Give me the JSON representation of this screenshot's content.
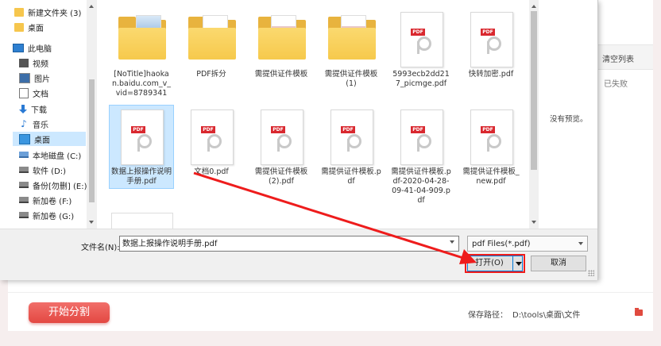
{
  "app": {
    "clear_list": "清空列表",
    "failed": "已失败",
    "start_button": "开始分割",
    "save_label": "保存路径：",
    "save_path": "D:\\tools\\桌面\\文件"
  },
  "nav": {
    "items": [
      {
        "label": "新建文件夹 (3)",
        "icon": "folder-icon"
      },
      {
        "label": "桌面",
        "icon": "folder-icon"
      },
      {
        "label": "此电脑",
        "icon": "computer-icon"
      },
      {
        "label": "视频",
        "icon": "video-icon"
      },
      {
        "label": "图片",
        "icon": "pictures-icon"
      },
      {
        "label": "文档",
        "icon": "document-icon"
      },
      {
        "label": "下载",
        "icon": "download-icon"
      },
      {
        "label": "音乐",
        "icon": "music-icon"
      },
      {
        "label": "桌面",
        "icon": "desktop-icon"
      },
      {
        "label": "本地磁盘 (C:)",
        "icon": "drive-c-icon"
      },
      {
        "label": "软件 (D:)",
        "icon": "drive-icon"
      },
      {
        "label": "备份[勿删] (E:)",
        "icon": "drive-icon"
      },
      {
        "label": "新加卷 (F:)",
        "icon": "drive-icon"
      },
      {
        "label": "新加卷 (G:)",
        "icon": "drive-icon"
      }
    ],
    "selected_index": 8
  },
  "files": [
    {
      "name": "[NoTitle]haokan.baidu.com_v_vid=8789341",
      "type": "folder"
    },
    {
      "name": "PDF拆分",
      "type": "folder"
    },
    {
      "name": "需提供证件模板",
      "type": "folder"
    },
    {
      "name": "需提供证件模板 (1)",
      "type": "folder"
    },
    {
      "name": "5993ecb2dd217_picmge.pdf",
      "type": "pdf"
    },
    {
      "name": "快转加密.pdf",
      "type": "pdf"
    },
    {
      "name": "数据上报操作说明手册.pdf",
      "type": "pdf",
      "selected": true
    },
    {
      "name": "文档0.pdf",
      "type": "pdf"
    },
    {
      "name": "需提供证件模板 (2).pdf",
      "type": "pdf"
    },
    {
      "name": "需提供证件模板.pdf",
      "type": "pdf"
    },
    {
      "name": "需提供证件模板.pdf-2020-04-28-09-41-04-909.pdf",
      "type": "pdf"
    },
    {
      "name": "需提供证件模板_new.pdf",
      "type": "pdf"
    }
  ],
  "preview": {
    "text": "没有预览。"
  },
  "filename": {
    "label": "文件名(N):",
    "value": "数据上报操作说明手册.pdf"
  },
  "filetype": {
    "selected": "pdf Files(*.pdf)"
  },
  "buttons": {
    "open": "打开(O)",
    "cancel": "取消"
  },
  "pdf_badge": "PDF",
  "colors": {
    "accent": "#e34842",
    "selection": "#cce8ff",
    "arrow": "#ee1c1c"
  }
}
